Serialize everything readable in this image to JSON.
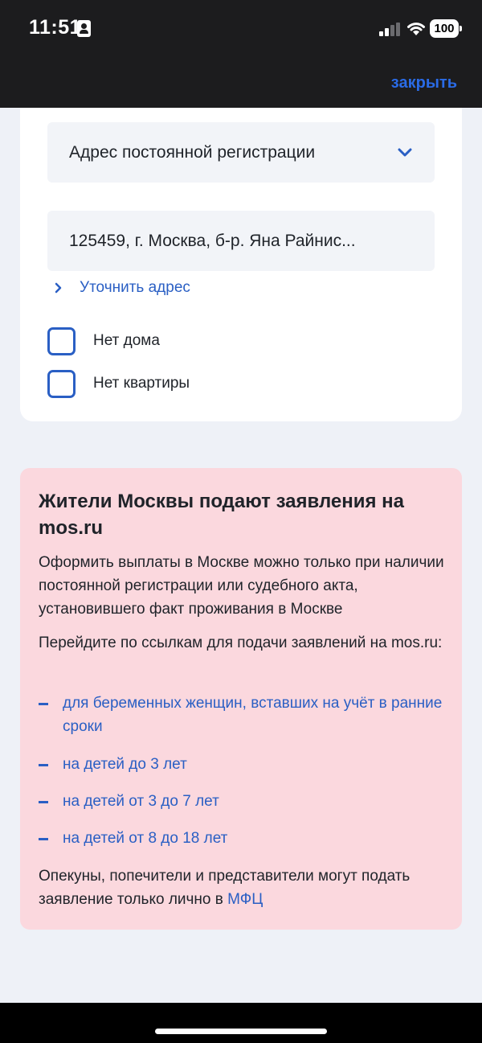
{
  "status_bar": {
    "time": "11:51",
    "battery": "100"
  },
  "nav": {
    "close_label": "закрыть"
  },
  "form": {
    "address_type": "Адрес постоянной регистрации",
    "address_value": "125459, г. Москва, б-р. Яна Райнис...",
    "refine_link": "Уточнить адрес",
    "checkboxes": [
      {
        "label": "Нет дома",
        "checked": false
      },
      {
        "label": "Нет квартиры",
        "checked": false
      }
    ]
  },
  "notice": {
    "title": "Жители Москвы подают заявления на mos.ru",
    "paragraph1": "Оформить выплаты в Москве можно только при наличии постоянной регистрации или судебного акта, установившего факт проживания в Москве",
    "paragraph2": "Перейдите по ссылкам для подачи заявлений на mos.ru:",
    "links": [
      "для беременных женщин, вставших на учёт в ранние сроки",
      "на детей до 3 лет",
      "на детей от 3 до 7 лет",
      "на детей от 8 до 18 лет"
    ],
    "footer_text": "Опекуны, попечители и представители могут подать заявление только лично в ",
    "footer_link": "МФЦ"
  },
  "colors": {
    "accent": "#2a5fc4",
    "notice_bg": "#fbd8de",
    "page_bg": "#eef1f7",
    "header_bg": "#1c1c1e"
  }
}
